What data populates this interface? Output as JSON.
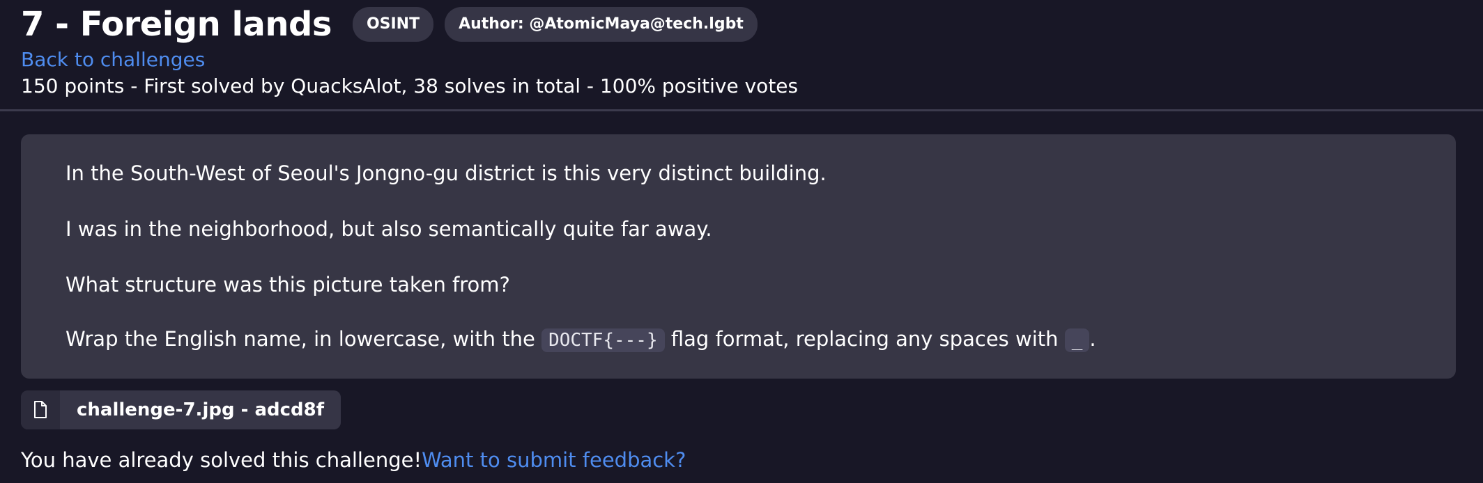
{
  "challenge": {
    "title": "7 - Foreign lands",
    "category": "OSINT",
    "author": "Author: @AtomicMaya@tech.lgbt",
    "back_link": "Back to challenges",
    "stats": "150 points - First solved by QuacksAlot, 38 solves in total - 100% positive votes"
  },
  "description": {
    "line1": "In the South-West of Seoul's Jongno-gu district is this very distinct building.",
    "line2": "I was in the neighborhood, but also semantically quite far away.",
    "line3": "What structure was this picture taken from?",
    "line4_before": "Wrap the English name, in lowercase, with the ",
    "flag_format": "DOCTF{---}",
    "line4_middle": " flag format, replacing any spaces with ",
    "space_replacement": "_",
    "line4_after": "."
  },
  "attachment": {
    "icon": "file-icon",
    "label": "challenge-7.jpg - adcd8f"
  },
  "footer": {
    "solved_text": "You have already solved this challenge!",
    "feedback_link": "Want to submit feedback?"
  },
  "colors": {
    "background": "#181726",
    "card": "#373645",
    "pill": "#363546",
    "link": "#4f8df0"
  }
}
